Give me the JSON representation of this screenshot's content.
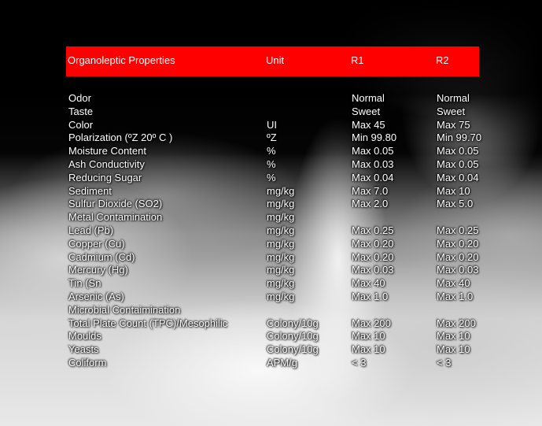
{
  "header": {
    "property": "Organoleptic Properties",
    "unit": "Unit",
    "r1": "R1",
    "r2": "R2",
    "color": "#ff0000"
  },
  "rows": [
    {
      "property": "Odor",
      "unit": "",
      "r1": "Normal",
      "r2": "Normal"
    },
    {
      "property": "Taste",
      "unit": "",
      "r1": "Sweet",
      "r2": "Sweet"
    },
    {
      "property": "Color",
      "unit": "UI",
      "r1": "Max 45",
      "r2": "Max 75"
    },
    {
      "property": "Polarization (ºZ 20º C )",
      "unit": "ºZ",
      "r1": "Min 99.80",
      "r2": "Min 99.70"
    },
    {
      "property": "Moisture Content",
      "unit": "%",
      "r1": "Max 0.05",
      "r2": "Max 0.05"
    },
    {
      "property": "Ash Conductivity",
      "unit": "%",
      "r1": "Max 0.03",
      "r2": "Max 0.05"
    },
    {
      "property": "Reducing Sugar",
      "unit": "%",
      "r1": "Max 0.04",
      "r2": "Max 0.04"
    },
    {
      "property": "Sediment",
      "unit": "mg/kg",
      "r1": "Max 7.0",
      "r2": "Max 10"
    },
    {
      "property": "Sulfur Dioxide (SO2)",
      "unit": "mg/kg",
      "r1": "Max 2.0",
      "r2": "Max 5.0"
    },
    {
      "property": "Metal Contamination",
      "unit": "mg/kg",
      "r1": "",
      "r2": ""
    },
    {
      "property": "Lead (Pb)",
      "unit": "mg/kg",
      "r1": "Max 0.25",
      "r2": "Max 0.25"
    },
    {
      "property": "Copper (Cu)",
      "unit": "mg/kg",
      "r1": "Max 0.20",
      "r2": "Max 0.20"
    },
    {
      "property": "Cadmium (Cd)",
      "unit": "mg/kg",
      "r1": "Max 0.20",
      "r2": "Max 0.20"
    },
    {
      "property": "Mercury (Hg)",
      "unit": "mg/kg",
      "r1": "Max 0.03",
      "r2": "Max 0.03"
    },
    {
      "property": "Tin (Sn",
      "unit": "mg/kg",
      "r1": "Max 40",
      "r2": "Max 40"
    },
    {
      "property": "Arsenic (As)",
      "unit": "mg/kg",
      "r1": "Max 1.0",
      "r2": "Max 1.0"
    },
    {
      "property": "Microbial Contaimination",
      "unit": "",
      "r1": "",
      "r2": ""
    },
    {
      "property": "Total Plate Count (TPC)/Mesophilic",
      "unit": "Colony/10g",
      "r1": "Max 200",
      "r2": "Max 200"
    },
    {
      "property": "Moulds",
      "unit": "Colony/10g",
      "r1": "Max 10",
      "r2": "Max 10"
    },
    {
      "property": "Yeasts",
      "unit": "Colony/10g",
      "r1": "Max 10",
      "r2": "Max 10"
    },
    {
      "property": "Coliform",
      "unit": "APM/g",
      "r1": "< 3",
      "r2": "< 3"
    }
  ]
}
